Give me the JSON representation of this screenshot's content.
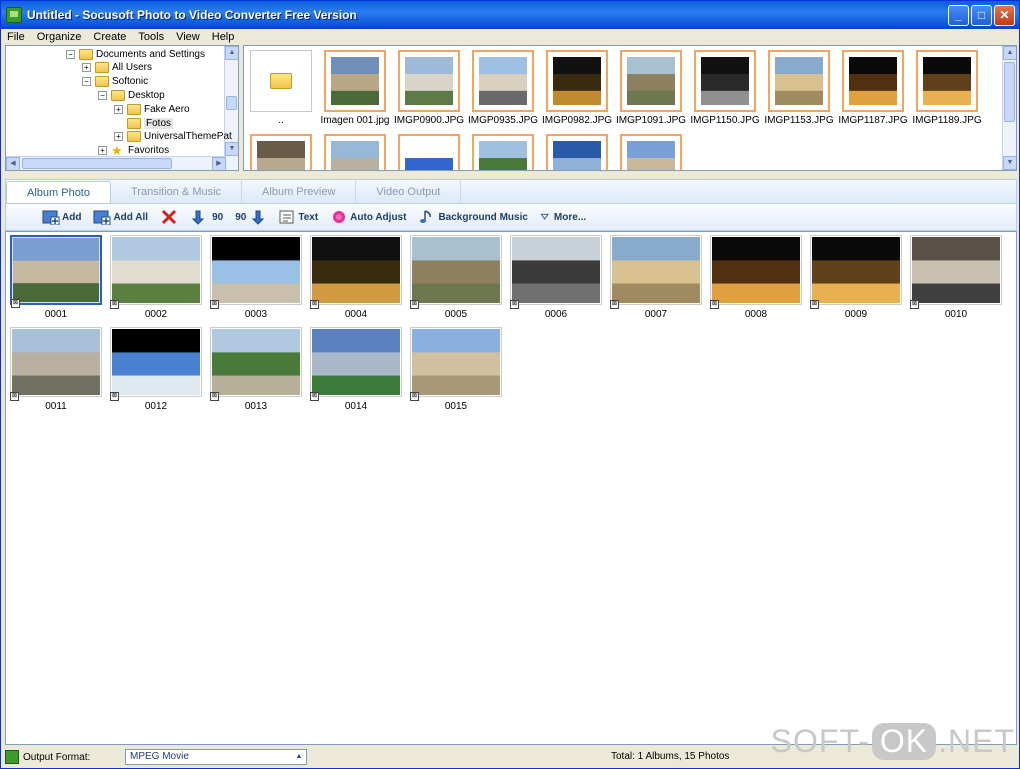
{
  "window": {
    "title": "Untitled - Socusoft Photo to Video Converter Free Version",
    "minimize": "_",
    "maximize": "□",
    "close": "✕"
  },
  "menu": [
    "File",
    "Organize",
    "Create",
    "Tools",
    "View",
    "Help"
  ],
  "tree": [
    {
      "label": "Documents and Settings",
      "expander": "−",
      "icon": "folder-open-icon"
    },
    {
      "label": "All Users",
      "expander": "+",
      "icon": "folder-icon"
    },
    {
      "label": "Softonic",
      "expander": "−",
      "icon": "folder-open-icon"
    },
    {
      "label": "Desktop",
      "expander": "−",
      "icon": "folder-open-icon"
    },
    {
      "label": "Fake Aero",
      "expander": "+",
      "icon": "folder-icon"
    },
    {
      "label": "Fotos",
      "expander": "",
      "icon": "folder-icon",
      "selected": true
    },
    {
      "label": "UniversalThemePat",
      "expander": "+",
      "icon": "folder-icon"
    },
    {
      "label": "Favoritos",
      "expander": "+",
      "icon": "star-icon"
    }
  ],
  "files": [
    {
      "name": "..",
      "folder": true
    },
    {
      "name": "Imagen 001.jpg",
      "colors": [
        "#6f8fb8",
        "#b8a888",
        "#4a6a3a"
      ]
    },
    {
      "name": "IMGP0900.JPG",
      "colors": [
        "#9fb9d9",
        "#d9d4c8",
        "#5d7a48"
      ]
    },
    {
      "name": "IMGP0935.JPG",
      "colors": [
        "#9dc0e4",
        "#d8cfbc",
        "#6a6a6a"
      ]
    },
    {
      "name": "IMGP0982.JPG",
      "colors": [
        "#111111",
        "#3a2a10",
        "#c08a30"
      ]
    },
    {
      "name": "IMGP1091.JPG",
      "colors": [
        "#a8c0d0",
        "#8c8060",
        "#6e7850"
      ]
    },
    {
      "name": "IMGP1150.JPG",
      "colors": [
        "#111111",
        "#2a2a2a",
        "#909090"
      ]
    },
    {
      "name": "IMGP1153.JPG",
      "colors": [
        "#88aacc",
        "#d8c090",
        "#a08a60"
      ]
    },
    {
      "name": "IMGP1187.JPG",
      "colors": [
        "#0a0a0a",
        "#503010",
        "#e0a040"
      ]
    },
    {
      "name": "IMGP1189.JPG",
      "colors": [
        "#0a0a0a",
        "#604018",
        "#e8b050"
      ]
    },
    {
      "name": "",
      "colors": [
        "#6a5a48",
        "#b8a890",
        "#504030"
      ]
    },
    {
      "name": "",
      "colors": [
        "#98b8d8",
        "#b8b0a0",
        "#707060"
      ]
    },
    {
      "name": "",
      "colors": [
        "#ffffff",
        "#3366cc",
        "#ffffff"
      ]
    },
    {
      "name": "",
      "colors": [
        "#a0c0e0",
        "#4a7a3a",
        "#7a9a5a"
      ]
    },
    {
      "name": "",
      "colors": [
        "#2a5aa8",
        "#90b0d8",
        "#404040"
      ]
    },
    {
      "name": "",
      "colors": [
        "#7aa0d8",
        "#c8b898",
        "#a89878"
      ]
    }
  ],
  "tabs": [
    "Album Photo",
    "Transition & Music",
    "Album Preview",
    "Video Output"
  ],
  "toolbar": {
    "add": "Add",
    "add_all": "Add All",
    "rotate_left": "90",
    "rotate_right": "90",
    "text": "Text",
    "auto_adjust": "Auto Adjust",
    "background_music": "Background Music",
    "more": "More..."
  },
  "photos": [
    {
      "label": "0001",
      "colors": [
        "#7a9ed0",
        "#c8b8a0",
        "#4a6a3a"
      ],
      "selected": true
    },
    {
      "label": "0002",
      "colors": [
        "#b0c8e0",
        "#e0dcd0",
        "#5a8040"
      ]
    },
    {
      "label": "0003",
      "colors": [
        "#000000",
        "#9ac0e8",
        "#c8bfac"
      ]
    },
    {
      "label": "0004",
      "colors": [
        "#101010",
        "#3a2a10",
        "#d09a40"
      ]
    },
    {
      "label": "0005",
      "colors": [
        "#a8c0d0",
        "#8c8060",
        "#6e7850"
      ]
    },
    {
      "label": "0006",
      "colors": [
        "#c8d0d8",
        "#3a3a3a",
        "#707070"
      ]
    },
    {
      "label": "0007",
      "colors": [
        "#88aacc",
        "#d8c090",
        "#a08a60"
      ]
    },
    {
      "label": "0008",
      "colors": [
        "#0a0a0a",
        "#503010",
        "#e0a040"
      ]
    },
    {
      "label": "0009",
      "colors": [
        "#0a0a0a",
        "#604018",
        "#e8b050"
      ]
    },
    {
      "label": "0010",
      "colors": [
        "#5a5048",
        "#c8c0b0",
        "#404040"
      ]
    },
    {
      "label": "0011",
      "colors": [
        "#a8c0d8",
        "#b8b0a0",
        "#707060"
      ]
    },
    {
      "label": "0012",
      "colors": [
        "#000000",
        "#4a80d0",
        "#e0e8f0"
      ]
    },
    {
      "label": "0013",
      "colors": [
        "#b0c8e0",
        "#4a7a3a",
        "#b8b098"
      ]
    },
    {
      "label": "0014",
      "colors": [
        "#5a80c0",
        "#a8b8c8",
        "#3a7a3a"
      ]
    },
    {
      "label": "0015",
      "colors": [
        "#8ab0e0",
        "#d0c0a0",
        "#a89878"
      ]
    }
  ],
  "status": {
    "output_format_label": "Output Format:",
    "output_format_value": "MPEG Movie",
    "total": "Total: 1 Albums, 15 Photos"
  },
  "watermark": {
    "left": "SOFT-",
    "ok": "OK",
    "right": ".NET"
  }
}
